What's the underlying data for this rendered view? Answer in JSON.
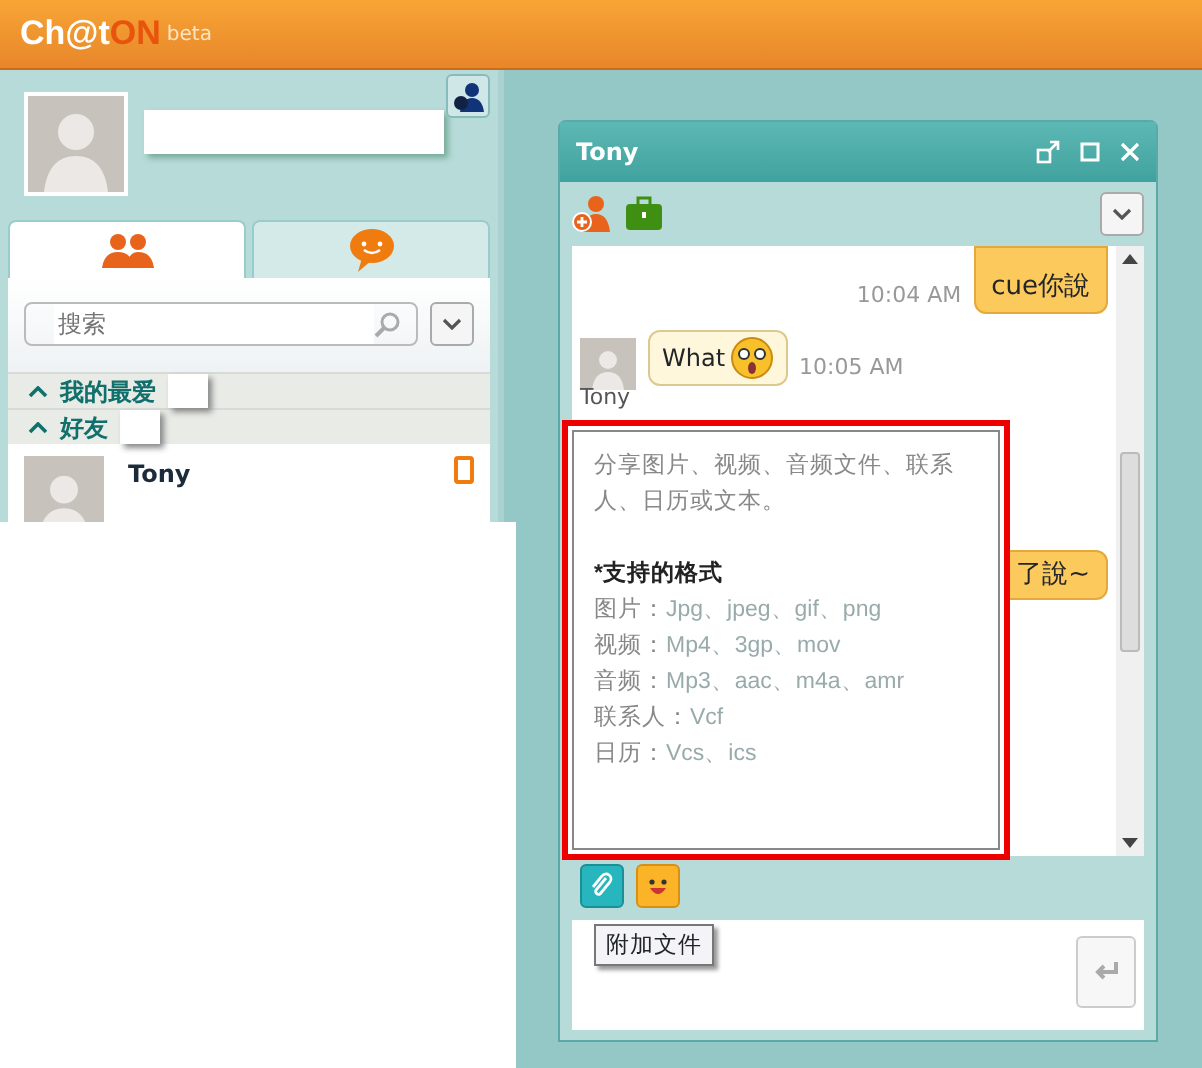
{
  "app": {
    "logo": "Ch@t",
    "logo_suffix": "ON",
    "badge": "beta"
  },
  "tabs": [
    {
      "kind": "contacts",
      "selected": true
    },
    {
      "kind": "chats",
      "selected": false
    }
  ],
  "search": {
    "placeholder": "搜索"
  },
  "groups": [
    {
      "label": "我的最爱",
      "expanded": true
    },
    {
      "label": "好友",
      "expanded": true
    }
  ],
  "contacts": [
    {
      "name": "Tony"
    }
  ],
  "chat": {
    "title": "Tony",
    "messages": [
      {
        "kind": "sent",
        "text": "cue你說",
        "time": "10:04 AM"
      },
      {
        "kind": "received",
        "text": "What",
        "time": "10:05 AM",
        "sender": "Tony"
      },
      {
        "kind": "sent",
        "text": "了說~"
      }
    ]
  },
  "popup": {
    "intro": "分享图片、视频、音频文件、联系人、日历或文本。",
    "heading": "*支持的格式",
    "formats": [
      {
        "label": "图片：",
        "value": "Jpg、jpeg、gif、png"
      },
      {
        "label": "视频：",
        "value": "Mp4、3gp、mov"
      },
      {
        "label": "音频：",
        "value": "Mp3、aac、m4a、amr"
      },
      {
        "label": "联系人：",
        "value": "Vcf"
      },
      {
        "label": "日历：",
        "value": "Vcs、ics"
      }
    ]
  },
  "tooltip": "附加文件"
}
